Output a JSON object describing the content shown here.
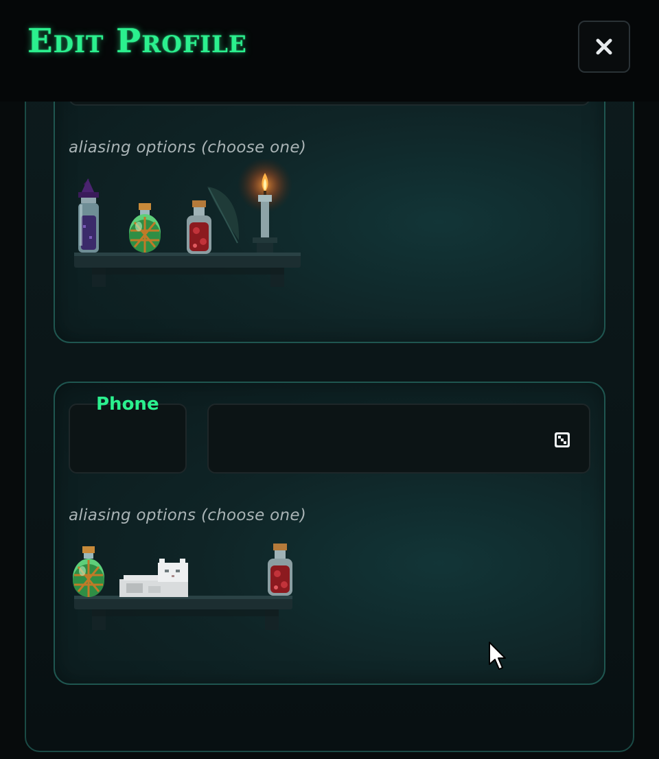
{
  "header": {
    "title": "Edit Profile",
    "close_label": "close"
  },
  "sections": [
    {
      "aliasing_label": "aliasing options (choose one)",
      "options": [
        "wizard-hat-potion-icon",
        "green-potion-icon",
        "red-potion-icon",
        "quill-icon",
        "candle-icon"
      ]
    },
    {
      "field_label": "Phone",
      "country_value": "",
      "number_value": "",
      "aliasing_label": "aliasing options (choose one)",
      "options": [
        "green-potion-icon",
        "white-cat-icon",
        "red-potion-icon"
      ]
    }
  ],
  "colors": {
    "accent": "#2bf08e",
    "card_border": "#1f5650",
    "background": "#070b0c"
  }
}
